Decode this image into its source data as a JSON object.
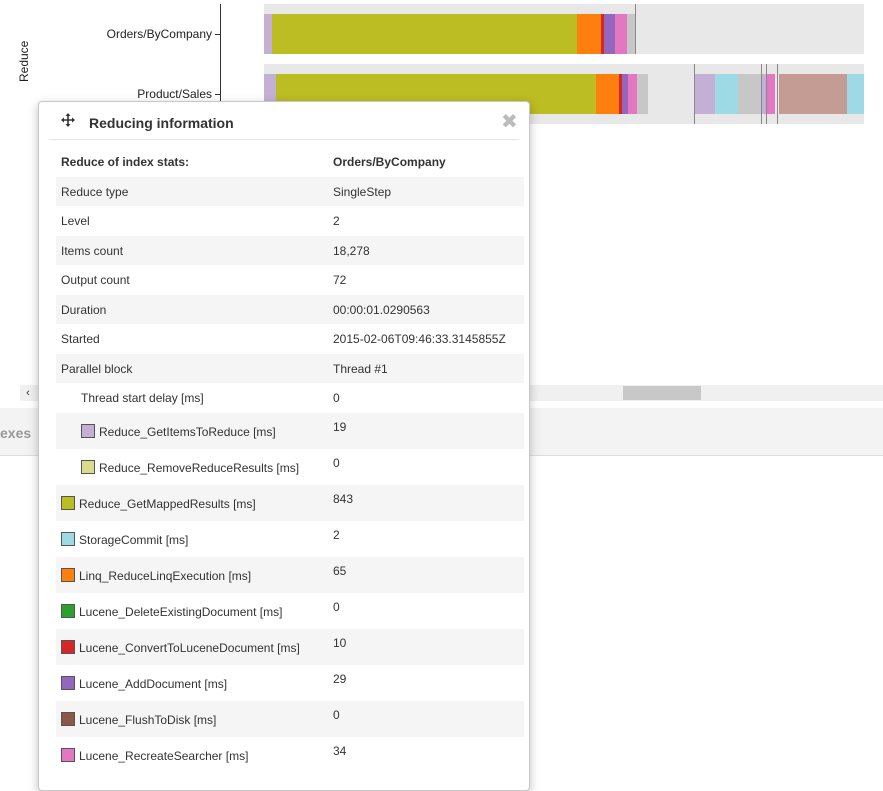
{
  "timeline": {
    "axis_label": "Reduce",
    "rows": [
      {
        "label": "Orders/ByCompany"
      },
      {
        "label": "Product/Sales"
      }
    ]
  },
  "lower_band": {
    "tab_text": "exes"
  },
  "scrollbar": {
    "left_arrow": "‹"
  },
  "popover": {
    "title": "Reducing information",
    "close_glyph": "✖",
    "header_row": {
      "key": "Reduce of index stats:",
      "value": "Orders/ByCompany"
    },
    "rows": [
      {
        "key": "Reduce type",
        "value": "SingleStep"
      },
      {
        "key": "Level",
        "value": "2"
      },
      {
        "key": "Items count",
        "value": "18,278"
      },
      {
        "key": "Output count",
        "value": "72"
      },
      {
        "key": "Duration",
        "value": "00:00:01.0290563"
      },
      {
        "key": "Started",
        "value": "2015-02-06T09:46:33.3145855Z"
      },
      {
        "key": "Parallel block",
        "value": "Thread #1"
      },
      {
        "key": "Thread start delay [ms]",
        "value": "0",
        "indent": true
      },
      {
        "key": "Reduce_GetItemsToReduce [ms]",
        "value": "19",
        "indent": true,
        "color": "#c5b0d5"
      },
      {
        "key": "Reduce_RemoveReduceResults [ms]",
        "value": "0",
        "indent": true,
        "color": "#dbdb8d"
      },
      {
        "key": "Reduce_GetMappedResults [ms]",
        "value": "843",
        "color": "#bcbd22"
      },
      {
        "key": "StorageCommit [ms]",
        "value": "2",
        "color": "#9edae5"
      },
      {
        "key": "Linq_ReduceLinqExecution [ms]",
        "value": "65",
        "color": "#ff7f0e"
      },
      {
        "key": "Lucene_DeleteExistingDocument [ms]",
        "value": "0",
        "color": "#2ca02c"
      },
      {
        "key": "Lucene_ConvertToLuceneDocument [ms]",
        "value": "10",
        "color": "#d62728"
      },
      {
        "key": "Lucene_AddDocument [ms]",
        "value": "29",
        "color": "#9467bd"
      },
      {
        "key": "Lucene_FlushToDisk [ms]",
        "value": "0",
        "color": "#8c564b"
      },
      {
        "key": "Lucene_RecreateSearcher [ms]",
        "value": "34",
        "color": "#e377c2"
      }
    ]
  }
}
